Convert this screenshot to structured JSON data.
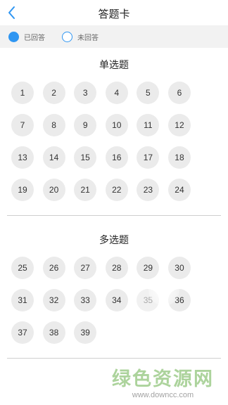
{
  "header": {
    "title": "答题卡"
  },
  "legend": {
    "answered": "已回答",
    "unanswered": "未回答"
  },
  "single": {
    "title": "单选题",
    "numbers": [
      "1",
      "2",
      "3",
      "4",
      "5",
      "6",
      "7",
      "8",
      "9",
      "10",
      "11",
      "12",
      "13",
      "14",
      "15",
      "16",
      "17",
      "18",
      "19",
      "20",
      "21",
      "22",
      "23",
      "24"
    ]
  },
  "multi": {
    "title": "多选题",
    "numbers": [
      "25",
      "26",
      "27",
      "28",
      "29",
      "30",
      "31",
      "32",
      "33",
      "34",
      "35",
      "36",
      "37",
      "38",
      "39"
    ]
  },
  "watermark": {
    "title": "绿色资源网",
    "url": "www.downcc.com"
  },
  "colors": {
    "accent": "#2f96f2",
    "cell_bg": "#ebebeb"
  }
}
